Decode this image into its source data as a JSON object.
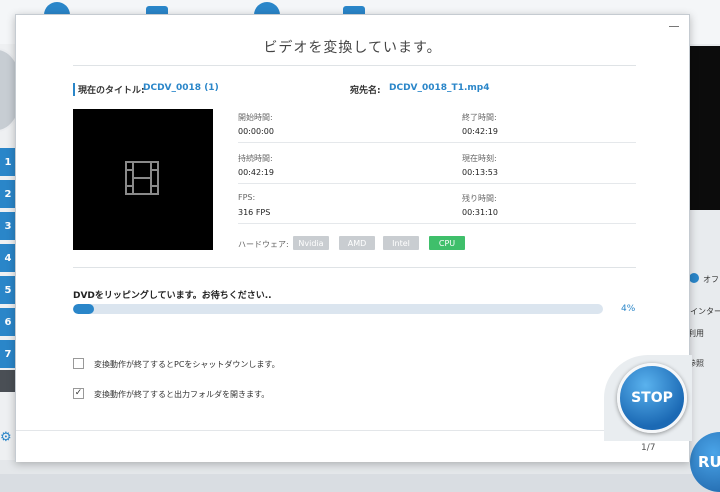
{
  "background": {
    "sidebar_numbers": [
      "1",
      "2",
      "3",
      "4",
      "5",
      "6",
      "7"
    ],
    "right_texts": [
      "オフ",
      "インターレ",
      "利用",
      "参照"
    ],
    "run_label": "RU"
  },
  "dialog": {
    "title": "ビデオを変換しています。",
    "current_title_label": "現在のタイトル:",
    "current_title_value": "DCDV_0018 (1)",
    "destination_label": "宛先名:",
    "destination_value": "DCDV_0018_T1.mp4",
    "info": {
      "start_time_label": "開始時間:",
      "start_time_value": "00:00:00",
      "end_time_label": "終了時間:",
      "end_time_value": "00:42:19",
      "duration_label": "持続時間:",
      "duration_value": "00:42:19",
      "current_time_label": "現在時刻:",
      "current_time_value": "00:13:53",
      "fps_label": "FPS:",
      "fps_value": "316 FPS",
      "remaining_label": "残り時間:",
      "remaining_value": "00:31:10"
    },
    "hardware": {
      "label": "ハードウェア:",
      "options": [
        {
          "label": "Nvidia",
          "active": false
        },
        {
          "label": "AMD",
          "active": false
        },
        {
          "label": "Intel",
          "active": false
        },
        {
          "label": "CPU",
          "active": true
        }
      ]
    },
    "progress": {
      "status_text": "DVDをリッピングしています。お待ちください..",
      "percent_text": "4%",
      "fraction": 0.04
    },
    "options": [
      {
        "label": "変換動作が終了するとPCをシャットダウンします。",
        "checked": false
      },
      {
        "label": "変換動作が終了すると出力フォルダを開きます。",
        "checked": true
      }
    ],
    "stop_label": "STOP",
    "page_indicator": "1/7"
  },
  "colors": {
    "accent": "#2a86c9",
    "cpu_active": "#3fbf6b",
    "hw_inactive": "#c9cdd1"
  }
}
